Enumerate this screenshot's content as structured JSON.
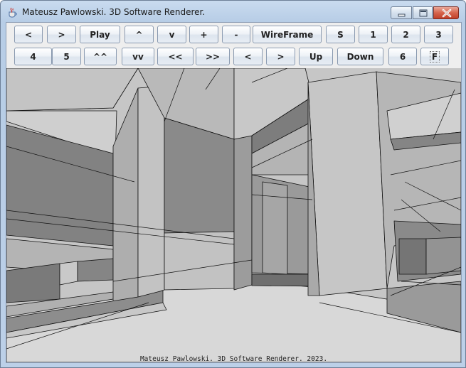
{
  "window": {
    "title": "Mateusz Pawlowski. 3D Software Renderer.",
    "app_icon": "java-coffee-cup-icon",
    "controls": [
      "minimize-icon",
      "maximize-icon",
      "close-icon"
    ],
    "close_color": "#c7432c"
  },
  "toolbar": {
    "row1": [
      "<",
      ">",
      "Play",
      "^",
      "v",
      "+",
      "-",
      "WireFrame",
      "S",
      "1",
      "2",
      "3"
    ],
    "row2": [
      "4",
      "5",
      "^^",
      "vv",
      "<<",
      ">>",
      "<",
      ">",
      "Up",
      "Down",
      "6",
      "F"
    ]
  },
  "viewport": {
    "caption": "Mateusz Pawlowski. 3D Software Renderer. 2023."
  }
}
